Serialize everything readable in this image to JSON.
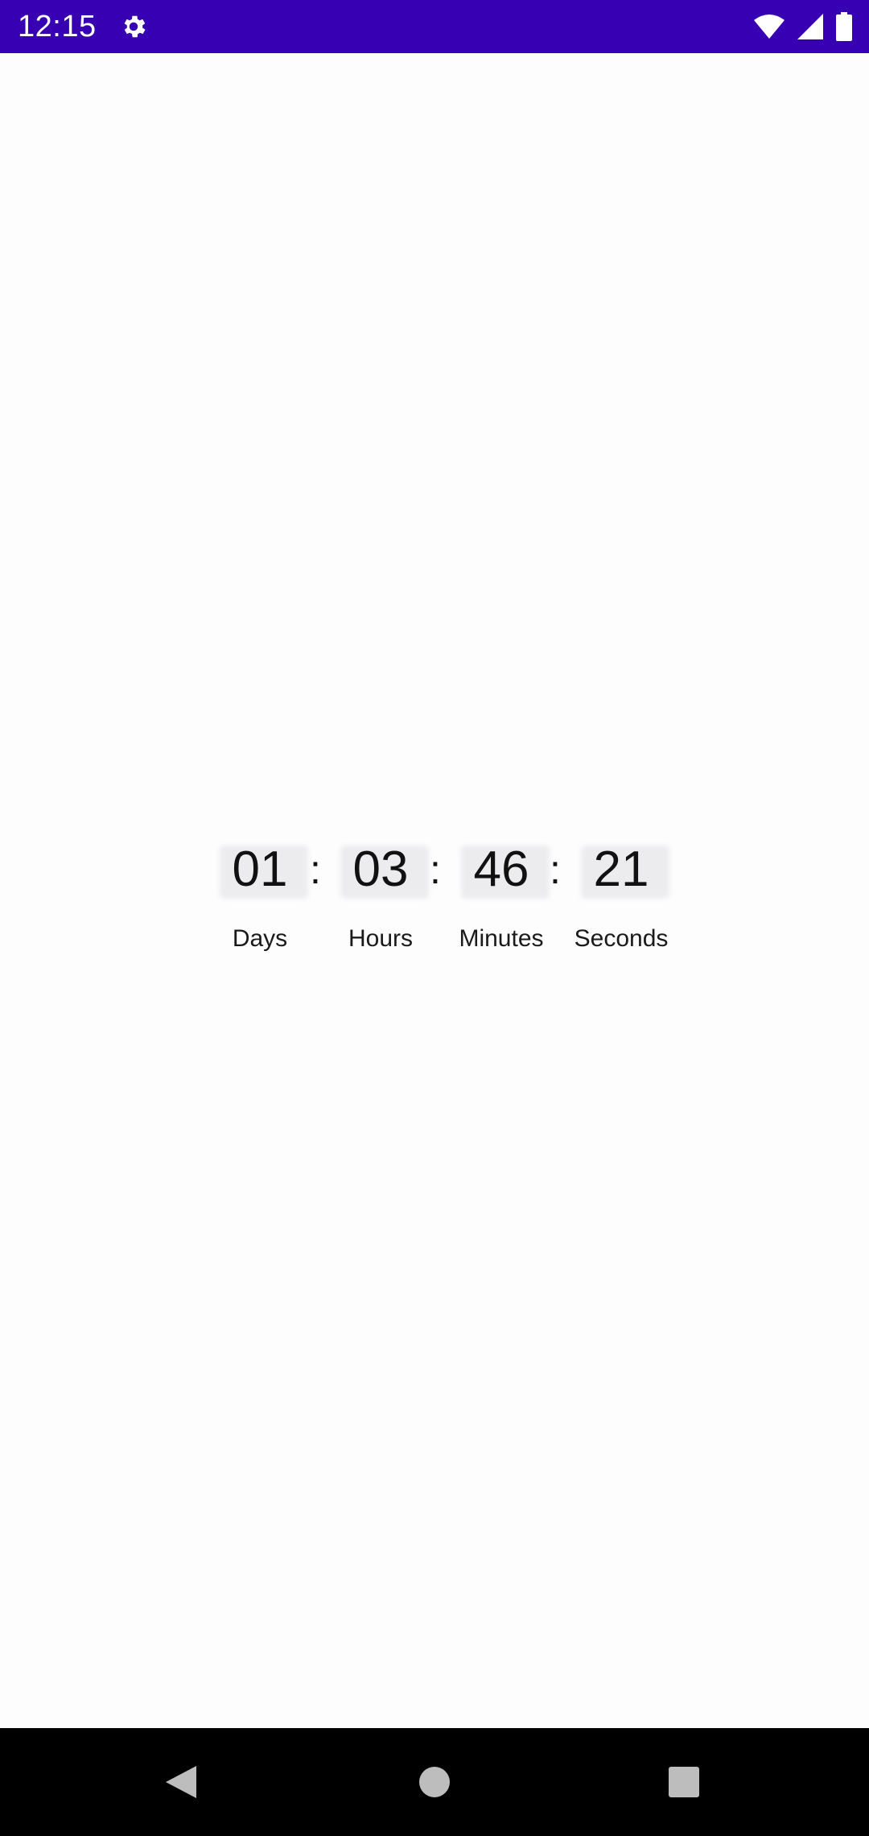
{
  "status_bar": {
    "time": "12:15",
    "icons": [
      "settings-gear-icon",
      "wifi-icon",
      "cell-signal-icon",
      "battery-icon"
    ],
    "background": "#3700b3"
  },
  "countdown": {
    "units": [
      {
        "value": "01",
        "label": "Days"
      },
      {
        "value": "03",
        "label": "Hours"
      },
      {
        "value": "46",
        "label": "Minutes"
      },
      {
        "value": "21",
        "label": "Seconds"
      }
    ],
    "separator": ":"
  },
  "nav_bar": {
    "buttons": [
      "back-icon",
      "home-icon",
      "recents-icon"
    ],
    "background": "#000000"
  }
}
